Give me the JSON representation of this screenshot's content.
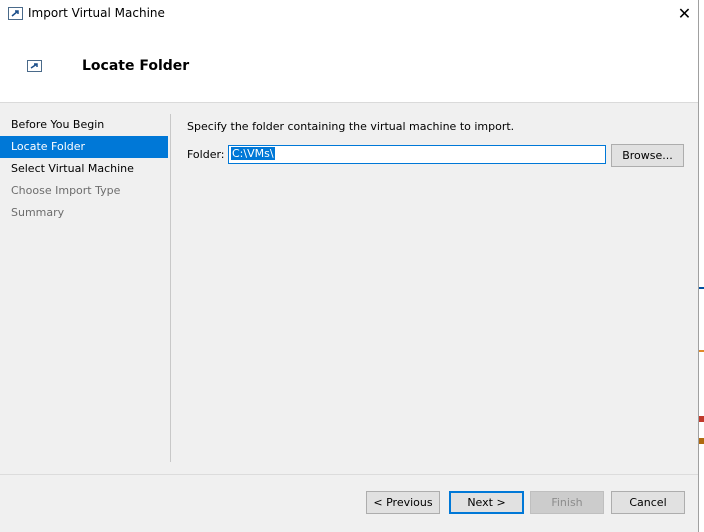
{
  "window": {
    "title": "Import Virtual Machine"
  },
  "header": {
    "title": "Locate Folder"
  },
  "nav": {
    "items": [
      {
        "label": "Before You Begin",
        "state": "normal"
      },
      {
        "label": "Locate Folder",
        "state": "active"
      },
      {
        "label": "Select Virtual Machine",
        "state": "normal"
      },
      {
        "label": "Choose Import Type",
        "state": "disabled"
      },
      {
        "label": "Summary",
        "state": "disabled"
      }
    ]
  },
  "main": {
    "instruction": "Specify the folder containing the virtual machine to import.",
    "folder_label": "Folder:",
    "folder_value": "C:\\VMs\\",
    "browse_label": "Browse..."
  },
  "buttons": {
    "previous": "< Previous",
    "next": "Next >",
    "finish": "Finish",
    "cancel": "Cancel"
  },
  "colors": {
    "accent": "#0078d7"
  }
}
